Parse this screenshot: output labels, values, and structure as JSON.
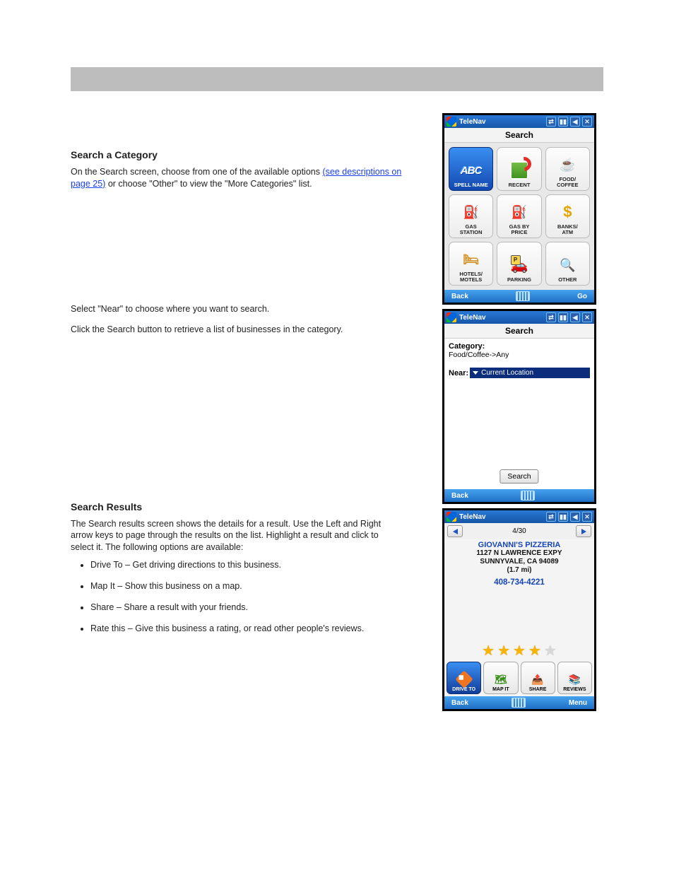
{
  "sections": {
    "searchCategory": {
      "title": "Search a Category",
      "p1a": "On the Search screen, choose from one of the available options ",
      "p1b": " or choose \"Other\" to view the \"More Categories\" list.",
      "link": "(see descriptions on page 25)",
      "p2": "Select \"Near\" to choose where you want to search.",
      "p3": "Click the Search button to retrieve a list of businesses in the category."
    },
    "searchResults": {
      "title": "Search Results",
      "intro": "The Search results screen shows the details for a result. Use the Left and Right arrow keys to page through the results on the list. Highlight a result and click to select it. The following options are available:",
      "bullets": [
        "Drive To – Get driving directions to this business.",
        "Map It – Show this business on a map.",
        "Share – Share a result with your friends.",
        "Rate this – Give this business a rating, or read other people's reviews."
      ]
    }
  },
  "device": {
    "topbarTitle": "TeleNav",
    "bottombar": {
      "back": "Back",
      "go": "Go",
      "menu": "Menu"
    }
  },
  "screen1": {
    "header": "Search",
    "tiles": [
      {
        "label": "SPELL NAME",
        "icon": "abc",
        "selected": true
      },
      {
        "label": "RECENT",
        "icon": "recent"
      },
      {
        "label": "FOOD/\nCOFFEE",
        "icon": "coffee"
      },
      {
        "label": "GAS\nSTATION",
        "icon": "gas"
      },
      {
        "label": "GAS BY\nPRICE",
        "icon": "gasbp"
      },
      {
        "label": "BANKS/\nATM",
        "icon": "bank"
      },
      {
        "label": "HOTELS/\nMOTELS",
        "icon": "hotel"
      },
      {
        "label": "PARKING",
        "icon": "parking"
      },
      {
        "label": "OTHER",
        "icon": "other"
      }
    ]
  },
  "screen2": {
    "header": "Search",
    "categoryLabel": "Category:",
    "categoryValue": "Food/Coffee->Any",
    "nearLabel": "Near:",
    "nearValue": "Current Location",
    "searchBtn": "Search"
  },
  "screen3": {
    "pager": "4/30",
    "name": "GIOVANNI'S PIZZERIA",
    "addr1": "1127 N LAWRENCE EXPY",
    "addr2": "SUNNYVALE, CA 94089",
    "addr3": "(1.7 mi)",
    "phone": "408-734-4221",
    "fullStars": 4,
    "totalStars": 5,
    "actions": [
      {
        "label": "DRIVE TO",
        "icon": "drive",
        "selected": true
      },
      {
        "label": "MAP IT",
        "icon": "map"
      },
      {
        "label": "SHARE",
        "icon": "share"
      },
      {
        "label": "REVIEWS",
        "icon": "rev"
      }
    ]
  }
}
